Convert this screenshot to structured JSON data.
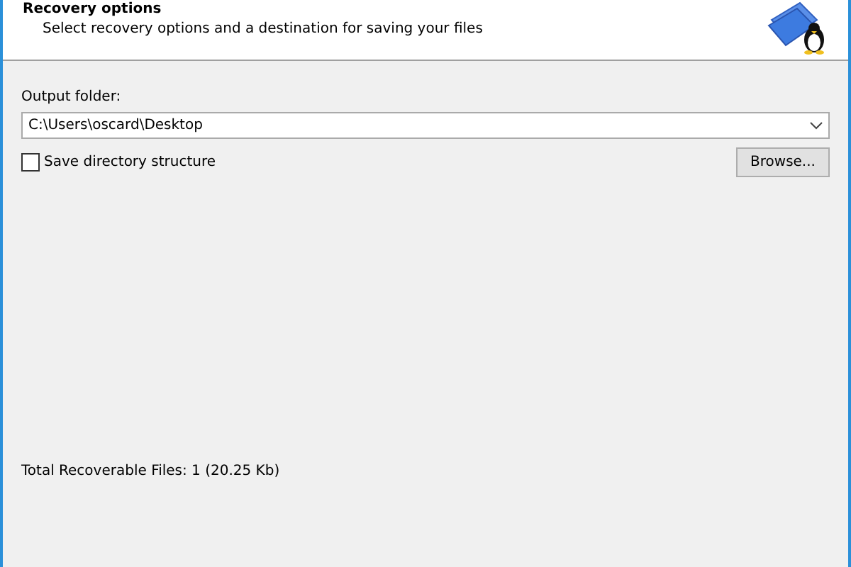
{
  "header": {
    "title": "Recovery options",
    "subtitle": "Select recovery options and a destination for saving your files"
  },
  "output_folder": {
    "label": "Output folder:",
    "value": "C:\\Users\\oscard\\Desktop"
  },
  "save_structure": {
    "label": "Save directory structure",
    "checked": false
  },
  "browse_button": "Browse...",
  "total": "Total Recoverable Files: 1 (20.25 Kb)"
}
